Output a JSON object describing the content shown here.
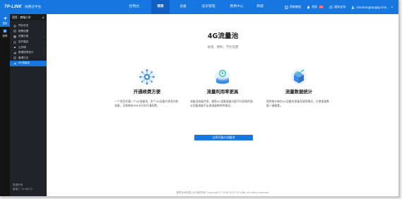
{
  "header": {
    "logo": "TP-LINK",
    "platform": "商用云平台",
    "nav": [
      {
        "label": "控制台",
        "active": false
      },
      {
        "label": "项目",
        "active": true
      },
      {
        "label": "设备",
        "active": false
      },
      {
        "label": "成员管理",
        "active": false
      },
      {
        "label": "费用中心",
        "active": false
      },
      {
        "label": "商城",
        "active": false
      }
    ],
    "right": {
      "help": "帮助教程",
      "notify": "消息",
      "notify_count": "99",
      "service": "服务支持",
      "user": "chenhongtao@tp-link..."
    }
  },
  "rail": [
    {
      "label": "监控",
      "icon": "monitor-icon",
      "active": true
    },
    {
      "label": "配置",
      "icon": "config-icon",
      "active": false
    }
  ],
  "sidebar": {
    "project_label": "项目：商城小学",
    "items": [
      {
        "label": "项目总览",
        "icon": "overview-icon",
        "chevron": true,
        "active": false
      },
      {
        "label": "报警设置",
        "icon": "alarm-icon",
        "chevron": true,
        "active": false
      },
      {
        "label": "设备分组",
        "icon": "group-icon",
        "chevron": true,
        "active": false
      },
      {
        "label": "定时重启",
        "icon": "clock-icon",
        "chevron": true,
        "active": false
      },
      {
        "label": "云存储",
        "icon": "cloud-icon",
        "chevron": true,
        "active": false
      },
      {
        "label": "数据报表统计",
        "icon": "report-icon",
        "chevron": true,
        "active": false
      },
      {
        "label": "管理日志",
        "icon": "log-icon",
        "chevron": false,
        "active": false
      },
      {
        "label": "4G流量池",
        "icon": "pool-icon",
        "chevron": false,
        "active": true
      }
    ],
    "footer_line1": "数据时间",
    "footer_line2": "星期三 14:06:52"
  },
  "main": {
    "title": "4G流量池",
    "subtitle": "省钱、便利、节约流量",
    "features": [
      {
        "icon": "network-icon",
        "title": "开通续费方便",
        "desc": "一个项目开通一个4G流量池，多个4G设备共享池内的流量，无需每张SIM卡分别开通续费。"
      },
      {
        "icon": "coin-stack-icon",
        "title": "流量利用率更高",
        "desc": "流量池流量共享，避免4G设备流量分配不均导致的部分设备流量不足或流量剩余的情况。"
      },
      {
        "icon": "data-cube-icon",
        "title": "流量数据统计",
        "desc": "提供统计每台4G设备的流量及使用情况，方便流量数据一键查看。"
      }
    ],
    "cta": "立即开通4G流量池",
    "footer": "普联技术有限公司 版权所有 Copyright © 2016-2022 TP-LINK. All rights reserved."
  },
  "colors": {
    "primary": "#1677e0",
    "sidebar_bg": "#202327",
    "rail_bg": "#141414"
  }
}
